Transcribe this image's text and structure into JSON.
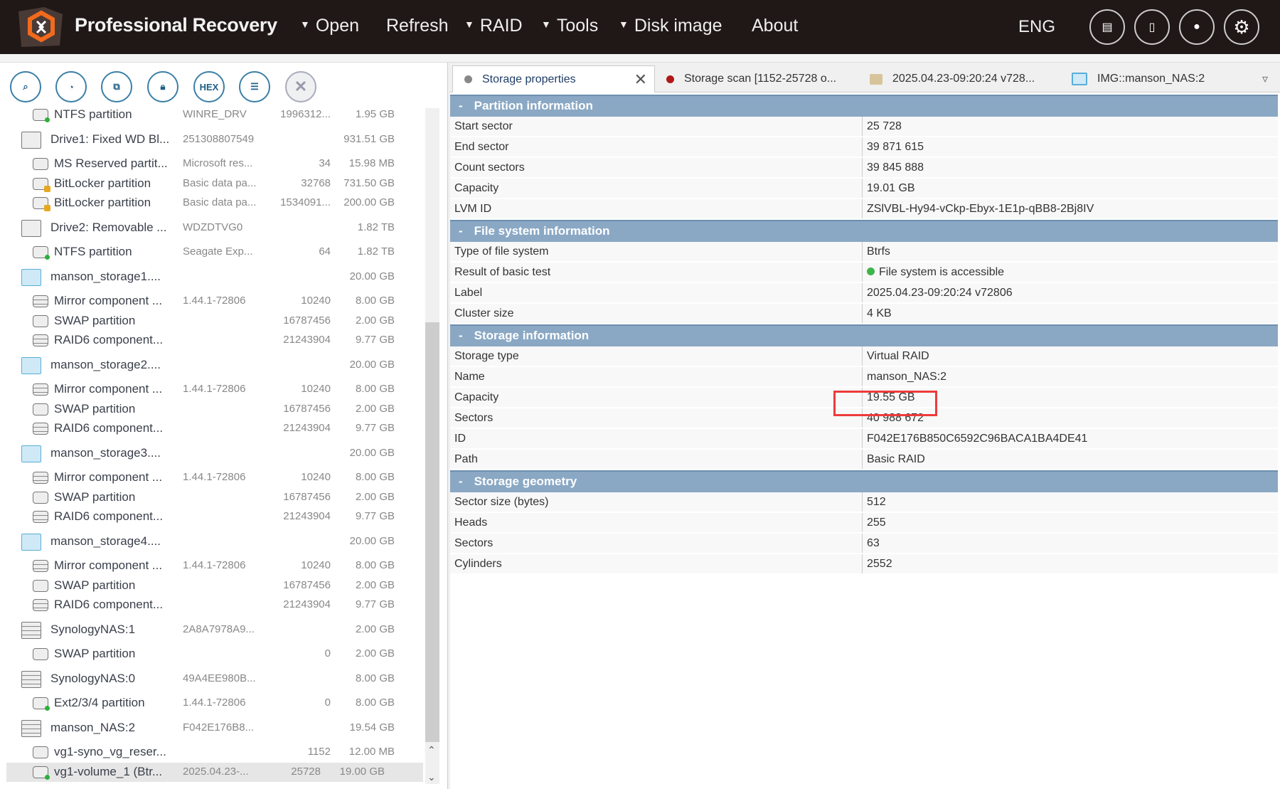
{
  "header": {
    "title": "Professional Recovery",
    "menu": [
      {
        "label": "Open",
        "dropdown": true
      },
      {
        "label": "Refresh",
        "dropdown": false
      },
      {
        "label": "RAID",
        "dropdown": true
      },
      {
        "label": "Tools",
        "dropdown": true
      },
      {
        "label": "Disk image",
        "dropdown": false
      },
      {
        "label": "About",
        "dropdown": false
      }
    ],
    "language": "ENG"
  },
  "toolbar": {
    "hex_label": "HEX"
  },
  "tree": [
    {
      "type": "child",
      "icon": "partition",
      "name": "NTFS partition",
      "c2": "WINRE_DRV",
      "c3": "1996312...",
      "size": "1.95 GB"
    },
    {
      "type": "parent",
      "icon": "drive",
      "name": "Drive1: Fixed WD Bl...",
      "c2": "251308807549",
      "c3": "",
      "size": "931.51 GB"
    },
    {
      "type": "child",
      "icon": "plain",
      "name": "MS Reserved partit...",
      "c2": "Microsoft res...",
      "c3": "34",
      "size": "15.98 MB"
    },
    {
      "type": "child",
      "icon": "locked",
      "name": "BitLocker partition",
      "c2": "Basic data pa...",
      "c3": "32768",
      "size": "731.50 GB"
    },
    {
      "type": "child",
      "icon": "locked",
      "name": "BitLocker partition",
      "c2": "Basic data pa...",
      "c3": "1534091...",
      "size": "200.00 GB"
    },
    {
      "type": "parent",
      "icon": "drive",
      "name": "Drive2: Removable ...",
      "c2": "WDZDTVG0",
      "c3": "",
      "size": "1.82 TB"
    },
    {
      "type": "child",
      "icon": "partition",
      "name": "NTFS partition",
      "c2": "Seagate Exp...",
      "c3": "64",
      "size": "1.82 TB"
    },
    {
      "type": "parent",
      "icon": "vol",
      "name": "manson_storage1....",
      "c2": "",
      "c3": "",
      "size": "20.00 GB"
    },
    {
      "type": "child",
      "icon": "raid",
      "name": "Mirror component ...",
      "c2": "1.44.1-72806",
      "c3": "10240",
      "size": "8.00 GB"
    },
    {
      "type": "child",
      "icon": "plain",
      "name": "SWAP partition",
      "c2": "",
      "c3": "16787456",
      "size": "2.00 GB"
    },
    {
      "type": "child",
      "icon": "raid",
      "name": "RAID6 component...",
      "c2": "",
      "c3": "21243904",
      "size": "9.77 GB"
    },
    {
      "type": "parent",
      "icon": "vol",
      "name": "manson_storage2....",
      "c2": "",
      "c3": "",
      "size": "20.00 GB"
    },
    {
      "type": "child",
      "icon": "raid",
      "name": "Mirror component ...",
      "c2": "1.44.1-72806",
      "c3": "10240",
      "size": "8.00 GB"
    },
    {
      "type": "child",
      "icon": "plain",
      "name": "SWAP partition",
      "c2": "",
      "c3": "16787456",
      "size": "2.00 GB"
    },
    {
      "type": "child",
      "icon": "raid",
      "name": "RAID6 component...",
      "c2": "",
      "c3": "21243904",
      "size": "9.77 GB"
    },
    {
      "type": "parent",
      "icon": "vol",
      "name": "manson_storage3....",
      "c2": "",
      "c3": "",
      "size": "20.00 GB"
    },
    {
      "type": "child",
      "icon": "raid",
      "name": "Mirror component ...",
      "c2": "1.44.1-72806",
      "c3": "10240",
      "size": "8.00 GB"
    },
    {
      "type": "child",
      "icon": "plain",
      "name": "SWAP partition",
      "c2": "",
      "c3": "16787456",
      "size": "2.00 GB"
    },
    {
      "type": "child",
      "icon": "raid",
      "name": "RAID6 component...",
      "c2": "",
      "c3": "21243904",
      "size": "9.77 GB"
    },
    {
      "type": "parent",
      "icon": "vol",
      "name": "manson_storage4....",
      "c2": "",
      "c3": "",
      "size": "20.00 GB"
    },
    {
      "type": "child",
      "icon": "raid",
      "name": "Mirror component ...",
      "c2": "1.44.1-72806",
      "c3": "10240",
      "size": "8.00 GB"
    },
    {
      "type": "child",
      "icon": "plain",
      "name": "SWAP partition",
      "c2": "",
      "c3": "16787456",
      "size": "2.00 GB"
    },
    {
      "type": "child",
      "icon": "raid",
      "name": "RAID6 component...",
      "c2": "",
      "c3": "21243904",
      "size": "9.77 GB"
    },
    {
      "type": "parent",
      "icon": "nas",
      "name": "SynologyNAS:1",
      "c2": "2A8A7978A9...",
      "c3": "",
      "size": "2.00 GB"
    },
    {
      "type": "child",
      "icon": "plain",
      "name": "SWAP partition",
      "c2": "",
      "c3": "0",
      "size": "2.00 GB"
    },
    {
      "type": "parent",
      "icon": "nas",
      "name": "SynologyNAS:0",
      "c2": "49A4EE980B...",
      "c3": "",
      "size": "8.00 GB"
    },
    {
      "type": "child",
      "icon": "partition",
      "name": "Ext2/3/4 partition",
      "c2": "1.44.1-72806",
      "c3": "0",
      "size": "8.00 GB"
    },
    {
      "type": "parent",
      "icon": "nas",
      "name": "manson_NAS:2",
      "c2": "F042E176B8...",
      "c3": "",
      "size": "19.54 GB"
    },
    {
      "type": "child",
      "icon": "plain",
      "name": "vg1-syno_vg_reser...",
      "c2": "",
      "c3": "1152",
      "size": "12.00 MB"
    },
    {
      "type": "child",
      "icon": "partition",
      "name": "vg1-volume_1 (Btr...",
      "c2": "2025.04.23-...",
      "c3": "25728",
      "size": "19.00 GB",
      "selected": true
    }
  ],
  "tabs": [
    {
      "label": "Storage properties",
      "dot": "#888888",
      "active": true
    },
    {
      "label": "Storage scan [1152-25728 o...",
      "dot": "#b01818"
    },
    {
      "label": "2025.04.23-09:20:24 v728...",
      "dot": "folder"
    },
    {
      "label": "IMG::manson_NAS:2",
      "dot": "image"
    }
  ],
  "sections": [
    {
      "title": "Partition information",
      "rows": [
        [
          "Start sector",
          "25 728"
        ],
        [
          "End sector",
          "39 871 615"
        ],
        [
          "Count sectors",
          "39 845 888"
        ],
        [
          "Capacity",
          "19.01 GB"
        ],
        [
          "LVM ID",
          "ZSlVBL-Hy94-vCkp-Ebyx-1E1p-qBB8-2Bj8IV"
        ]
      ]
    },
    {
      "title": "File system information",
      "rows": [
        [
          "Type of file system",
          "Btrfs"
        ],
        [
          "Result of basic test",
          "File system is accessible"
        ],
        [
          "Label",
          "2025.04.23-09:20:24 v72806"
        ],
        [
          "Cluster size",
          "4 KB"
        ]
      ]
    },
    {
      "title": "Storage information",
      "rows": [
        [
          "Storage type",
          "Virtual RAID"
        ],
        [
          "Name",
          "manson_NAS:2"
        ],
        [
          "Capacity",
          "19.55 GB"
        ],
        [
          "Sectors",
          "40 988 672"
        ],
        [
          "ID",
          "F042E176B850C6592C96BACA1BA4DE41"
        ],
        [
          "Path",
          "Basic RAID"
        ]
      ]
    },
    {
      "title": "Storage geometry",
      "rows": [
        [
          "Sector size (bytes)",
          "512"
        ],
        [
          "Heads",
          "255"
        ],
        [
          "Sectors",
          "63"
        ],
        [
          "Cylinders",
          "2552"
        ]
      ]
    }
  ],
  "collapse_symbol": "-"
}
